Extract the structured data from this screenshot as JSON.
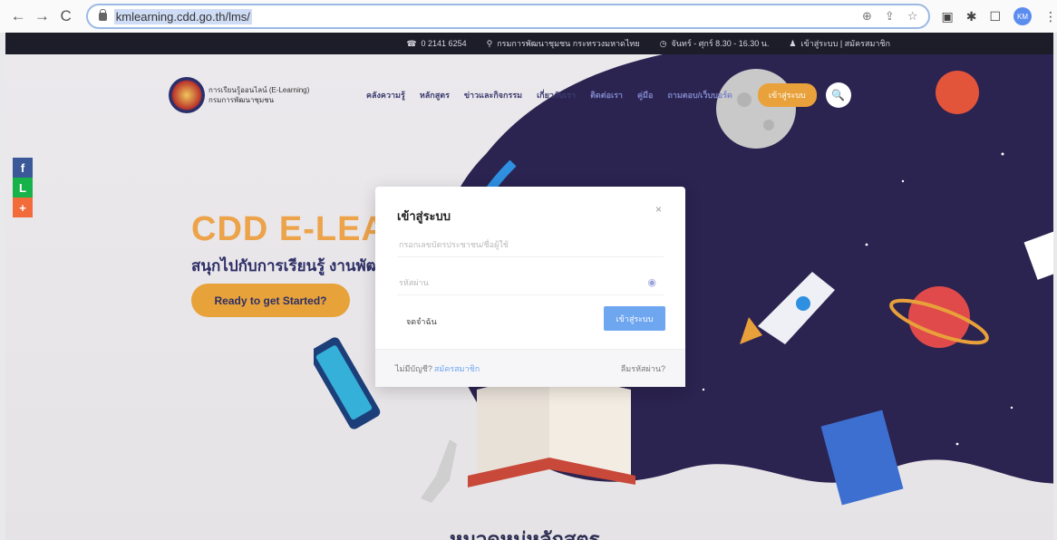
{
  "browser": {
    "url": "kmlearning.cdd.go.th/lms/",
    "profile_initials": "KM",
    "back_glyph": "←",
    "forward_glyph": "→",
    "reload_glyph": "C",
    "zoom_glyph": "⊕",
    "share_glyph": "⇪",
    "star_glyph": "☆",
    "ext1_glyph": "▣",
    "puzzle_glyph": "✱",
    "window_glyph": "☐",
    "menu_glyph": "⋮"
  },
  "topbar": {
    "phone": "0 2141 6254",
    "address": "กรมการพัฒนาชุมชน กระทรวงมหาดไทย",
    "hours": "จันทร์ - ศุกร์ 8.30 - 16.30 น.",
    "user": "เข้าสู่ระบบ | สมัครสมาชิก"
  },
  "site": {
    "logo_line1": "การเรียนรู้ออนไลน์ (E-Learning)",
    "logo_line2": "กรมการพัฒนาชุมชน",
    "menu": [
      "คลังความรู้",
      "หลักสูตร",
      "ข่าวและกิจกรรม",
      "เกี่ยวกับเรา",
      "ติดต่อเรา",
      "คู่มือ",
      "ถามตอบ/เว็บบอร์ด"
    ],
    "login_button": "เข้าสู่ระบบ",
    "search_glyph": "🔍"
  },
  "social": {
    "facebook": "f",
    "line": "L",
    "more": "+"
  },
  "hero": {
    "title": "CDD E-LEAR",
    "subtitle": "สนุกไปกับการเรียนรู้ งานพัฒ",
    "cta": "Ready to get Started?"
  },
  "modal": {
    "title": "เข้าสู่ระบบ",
    "close": "×",
    "username_placeholder": "กรอกเลขบัตรประชาชน/ชื่อผู้ใช้",
    "password_placeholder": "รหัสผ่าน",
    "eye_glyph": "◉",
    "remember": "จดจำฉัน",
    "submit": "เข้าสู่ระบบ",
    "no_account": "ไม่มีบัญชี?",
    "signup": "สมัครสมาชิก",
    "forgot": "ลืมรหัสผ่าน?"
  },
  "footer_heading": "หมวดหมู่หลักสูตร",
  "colors": {
    "accent": "#e7a23a",
    "navy": "#2d2f66",
    "space": "#2b2350",
    "button_blue": "#6ea6f0"
  }
}
